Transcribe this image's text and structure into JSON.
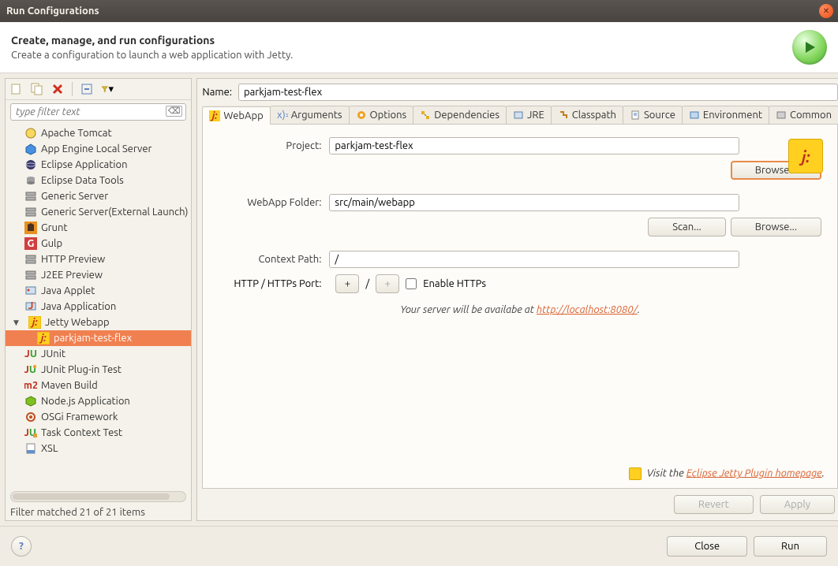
{
  "titlebar": {
    "title": "Run Configurations"
  },
  "header": {
    "title": "Create, manage, and run configurations",
    "subtitle": "Create a configuration to launch a web application with Jetty."
  },
  "left": {
    "filter_placeholder": "type filter text",
    "items": [
      {
        "label": "Apache Tomcat",
        "icon": "tomcat"
      },
      {
        "label": "App Engine Local Server",
        "icon": "appengine"
      },
      {
        "label": "Eclipse Application",
        "icon": "eclipse"
      },
      {
        "label": "Eclipse Data Tools",
        "icon": "datatools"
      },
      {
        "label": "Generic Server",
        "icon": "server"
      },
      {
        "label": "Generic Server(External Launch)",
        "icon": "server"
      },
      {
        "label": "Grunt",
        "icon": "grunt"
      },
      {
        "label": "Gulp",
        "icon": "gulp"
      },
      {
        "label": "HTTP Preview",
        "icon": "http"
      },
      {
        "label": "J2EE Preview",
        "icon": "j2ee"
      },
      {
        "label": "Java Applet",
        "icon": "applet"
      },
      {
        "label": "Java Application",
        "icon": "javaapp"
      },
      {
        "label": "Jetty Webapp",
        "icon": "jetty",
        "expanded": true,
        "children": [
          {
            "label": "parkjam-test-flex",
            "icon": "jetty",
            "selected": true
          }
        ]
      },
      {
        "label": "JUnit",
        "icon": "junit"
      },
      {
        "label": "JUnit Plug-in Test",
        "icon": "junitplugin"
      },
      {
        "label": "Maven Build",
        "icon": "maven"
      },
      {
        "label": "Node.js Application",
        "icon": "node"
      },
      {
        "label": "OSGi Framework",
        "icon": "osgi"
      },
      {
        "label": "Task Context Test",
        "icon": "task"
      },
      {
        "label": "XSL",
        "icon": "xsl"
      }
    ],
    "status": "Filter matched 21 of 21 items"
  },
  "right": {
    "name_label": "Name:",
    "name_value": "parkjam-test-flex",
    "tabs": [
      "WebApp",
      "Arguments",
      "Options",
      "Dependencies",
      "JRE",
      "Classpath",
      "Source",
      "Environment",
      "Common"
    ],
    "form": {
      "project_label": "Project:",
      "project_value": "parkjam-test-flex",
      "browse": "Browse...",
      "webapp_label": "WebApp Folder:",
      "webapp_value": "src/main/webapp",
      "scan": "Scan...",
      "context_label": "Context Path:",
      "context_value": "/",
      "port_label": "HTTP / HTTPs Port:",
      "port_sep": "/",
      "plus": "+",
      "enable_https": "Enable HTTPs",
      "server_msg_prefix": "Your server will be availabe at ",
      "server_url": "http://localhost:8080/",
      "homepage_prefix": "Visit the ",
      "homepage_link": "Eclipse Jetty Plugin homepage",
      "period": "."
    },
    "revert": "Revert",
    "apply": "Apply"
  },
  "footer": {
    "close": "Close",
    "run": "Run"
  }
}
